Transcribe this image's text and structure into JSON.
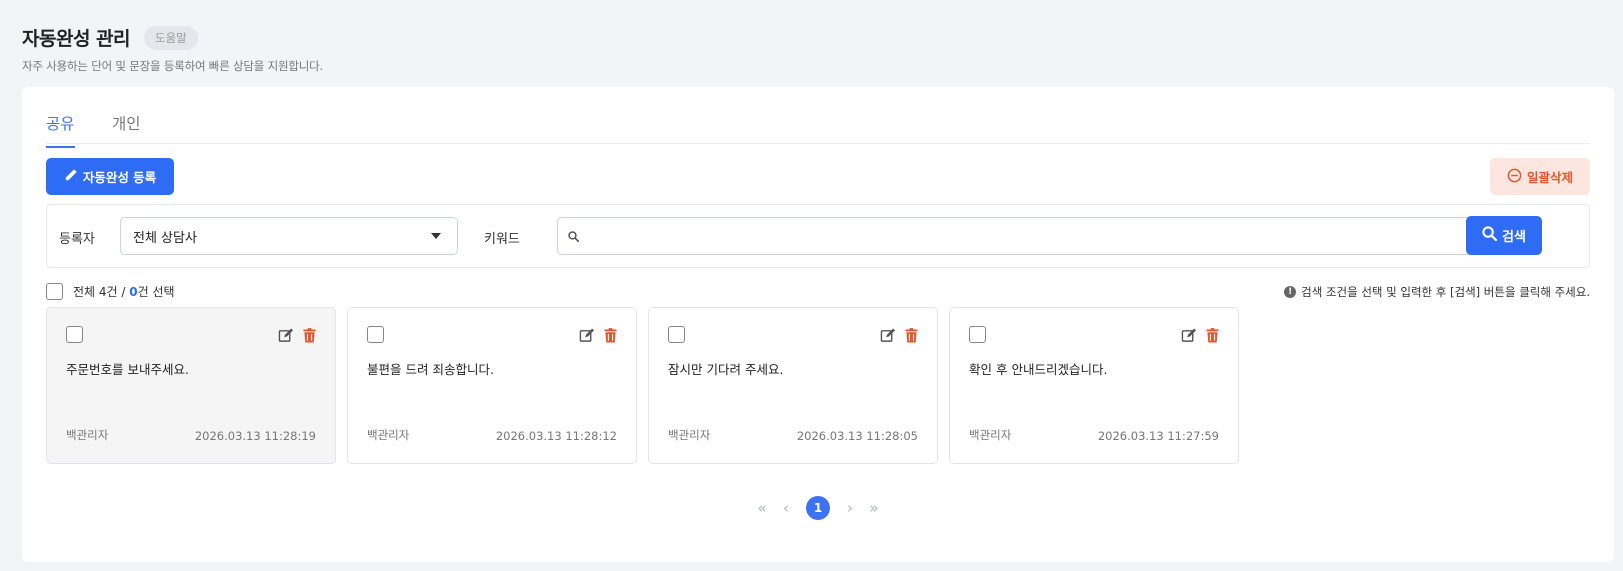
{
  "header": {
    "title": "자동완성 관리",
    "help_label": "도움말",
    "description": "자주 사용하는 단어 및 문장을 등록하여 빠른 상담을 지원합니다."
  },
  "tabs": [
    {
      "label": "공유",
      "active": true
    },
    {
      "label": "개인",
      "active": false
    }
  ],
  "toolbar": {
    "add_label": "자동완성 등록",
    "bulk_delete_label": "일괄삭제"
  },
  "filter": {
    "registrant_label": "등록자",
    "registrant_value": "전체 상담사",
    "keyword_label": "키워드",
    "keyword_value": "",
    "search_label": "검색"
  },
  "summary": {
    "total_text": "전체 4건 / ",
    "selected_count": "0",
    "selected_suffix": "건 선택",
    "notice": "검색 조건을 선택 및 입력한 후 [검색] 버튼을 클릭해 주세요."
  },
  "cards": [
    {
      "text": "주문번호를 보내주세요.",
      "author": "백관리자",
      "date": "2026.03.13 11:28:19"
    },
    {
      "text": "불편을 드려 죄송합니다.",
      "author": "백관리자",
      "date": "2026.03.13 11:28:12"
    },
    {
      "text": "잠시만 기다려 주세요.",
      "author": "백관리자",
      "date": "2026.03.13 11:28:05"
    },
    {
      "text": "확인 후 안내드리겠습니다.",
      "author": "백관리자",
      "date": "2026.03.13 11:27:59"
    }
  ],
  "pagination": {
    "current_page": "1"
  },
  "colors": {
    "primary": "#2f6cf5",
    "danger": "#e4572e",
    "danger_bg": "#fde6e0",
    "background": "#f3f4f8"
  },
  "icons": {
    "add": "pencil-icon",
    "bulk_delete": "minus-circle-icon",
    "search": "search-icon",
    "edit": "edit-icon",
    "delete": "trash-icon",
    "notice": "info-icon"
  }
}
